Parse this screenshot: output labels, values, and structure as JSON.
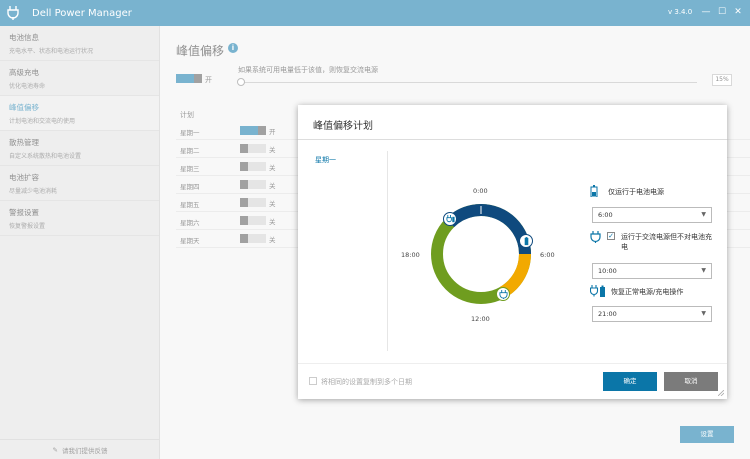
{
  "titlebar": {
    "title": "Dell Power Manager",
    "version": "v 3.4.0",
    "minimize": "—",
    "maximize": "☐",
    "close": "✕"
  },
  "sidebar": {
    "items": [
      {
        "title": "电池信息",
        "subtitle": "充电水平、状态和电池运行状况"
      },
      {
        "title": "高级充电",
        "subtitle": "优化电池寿命"
      },
      {
        "title": "峰值偏移",
        "subtitle": "计划电池和交流电的使用"
      },
      {
        "title": "散热管理",
        "subtitle": "自定义系统散热和电池设置"
      },
      {
        "title": "电池扩容",
        "subtitle": "尽量减少电池消耗"
      },
      {
        "title": "警报设置",
        "subtitle": "恢复警报设置"
      }
    ],
    "feedback": "请我们提供反馈"
  },
  "main": {
    "title": "峰值偏移",
    "toggle_label": "开",
    "threshold_text": "如果系统可用电量低于该值，则恢复交流电源",
    "threshold_value": "15%",
    "schedule_header": "计划",
    "days": [
      {
        "day": "星期一",
        "state": "开"
      },
      {
        "day": "星期二",
        "state": "关"
      },
      {
        "day": "星期三",
        "state": "关"
      },
      {
        "day": "星期四",
        "state": "关"
      },
      {
        "day": "星期五",
        "state": "关"
      },
      {
        "day": "星期六",
        "state": "关"
      },
      {
        "day": "星期天",
        "state": "关"
      }
    ],
    "settings_button": "设置"
  },
  "dialog": {
    "title": "峰值偏移计划",
    "day": "星期一",
    "clock_labels": {
      "top": "0:00",
      "right": "6:00",
      "bottom": "12:00",
      "left": "18:00"
    },
    "options": [
      {
        "label": "仅运行于电池电源",
        "value": "6:00"
      },
      {
        "label": "运行于交流电源但不对电池充电",
        "value": "10:00"
      },
      {
        "label": "恢复正常电源/充电操作",
        "value": "21:00"
      }
    ],
    "copy_label": "将相同的设置复制到多个日期",
    "ok": "确定",
    "cancel": "取消"
  },
  "colors": {
    "accent": "#0b76a8",
    "battery_segment": "#0f4a7e",
    "ac_no_charge_segment": "#f2a900",
    "normal_segment": "#6f9d1f"
  }
}
